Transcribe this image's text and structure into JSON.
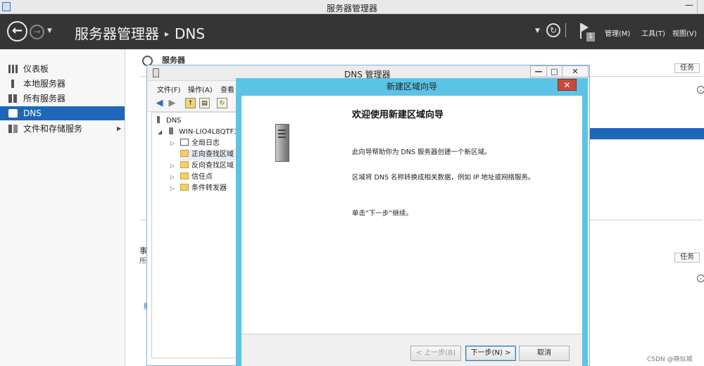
{
  "server_manager": {
    "title": "服务器管理器",
    "breadcrumb": [
      "服务器管理器",
      "DNS"
    ],
    "breadcrumb_sep": "▸",
    "notification_count": "1",
    "menus": {
      "manage": "管理(M)",
      "tools": "工具(T)",
      "view": "视图(V)"
    },
    "sidebar": [
      {
        "label": "仪表板",
        "icon": "dashboard-icon"
      },
      {
        "label": "本地服务器",
        "icon": "server-icon"
      },
      {
        "label": "所有服务器",
        "icon": "servers-icon"
      },
      {
        "label": "DNS",
        "icon": "dns-icon",
        "active": true
      },
      {
        "label": "文件和存储服务",
        "icon": "file-storage-icon",
        "has_children": true
      }
    ],
    "content": {
      "section_title": "服务器",
      "tasks_label": "任务",
      "events_title_fragment": "事",
      "events_sub_fragment": "所",
      "link_fragment": "服"
    }
  },
  "dns_manager": {
    "title": "DNS 管理器",
    "menu": [
      "文件(F)",
      "操作(A)",
      "查看"
    ],
    "tree": {
      "root": "DNS",
      "server": "WIN-LIO4L8QTF3",
      "children": [
        "全局日志",
        "正向查找区域",
        "反向查找区域",
        "信任点",
        "条件转发器"
      ]
    }
  },
  "wizard": {
    "title": "新建区域向导",
    "heading": "欢迎使用新建区域向导",
    "para1": "此向导帮助你为 DNS 服务器创建一个新区域。",
    "para2": "区域将 DNS 名称转换成相关数据，例如 IP 地址或网络服务。",
    "para3": "单击“下一步”继续。",
    "buttons": {
      "back": "< 上一步(B)",
      "next": "下一步(N) >",
      "cancel": "取消"
    }
  },
  "watermark": "CSDN @晓似城",
  "colors": {
    "header_bg": "#353535",
    "active_item": "#1e67b8",
    "wizard_frame": "#5bc4e6",
    "close_button": "#c74b3a"
  }
}
